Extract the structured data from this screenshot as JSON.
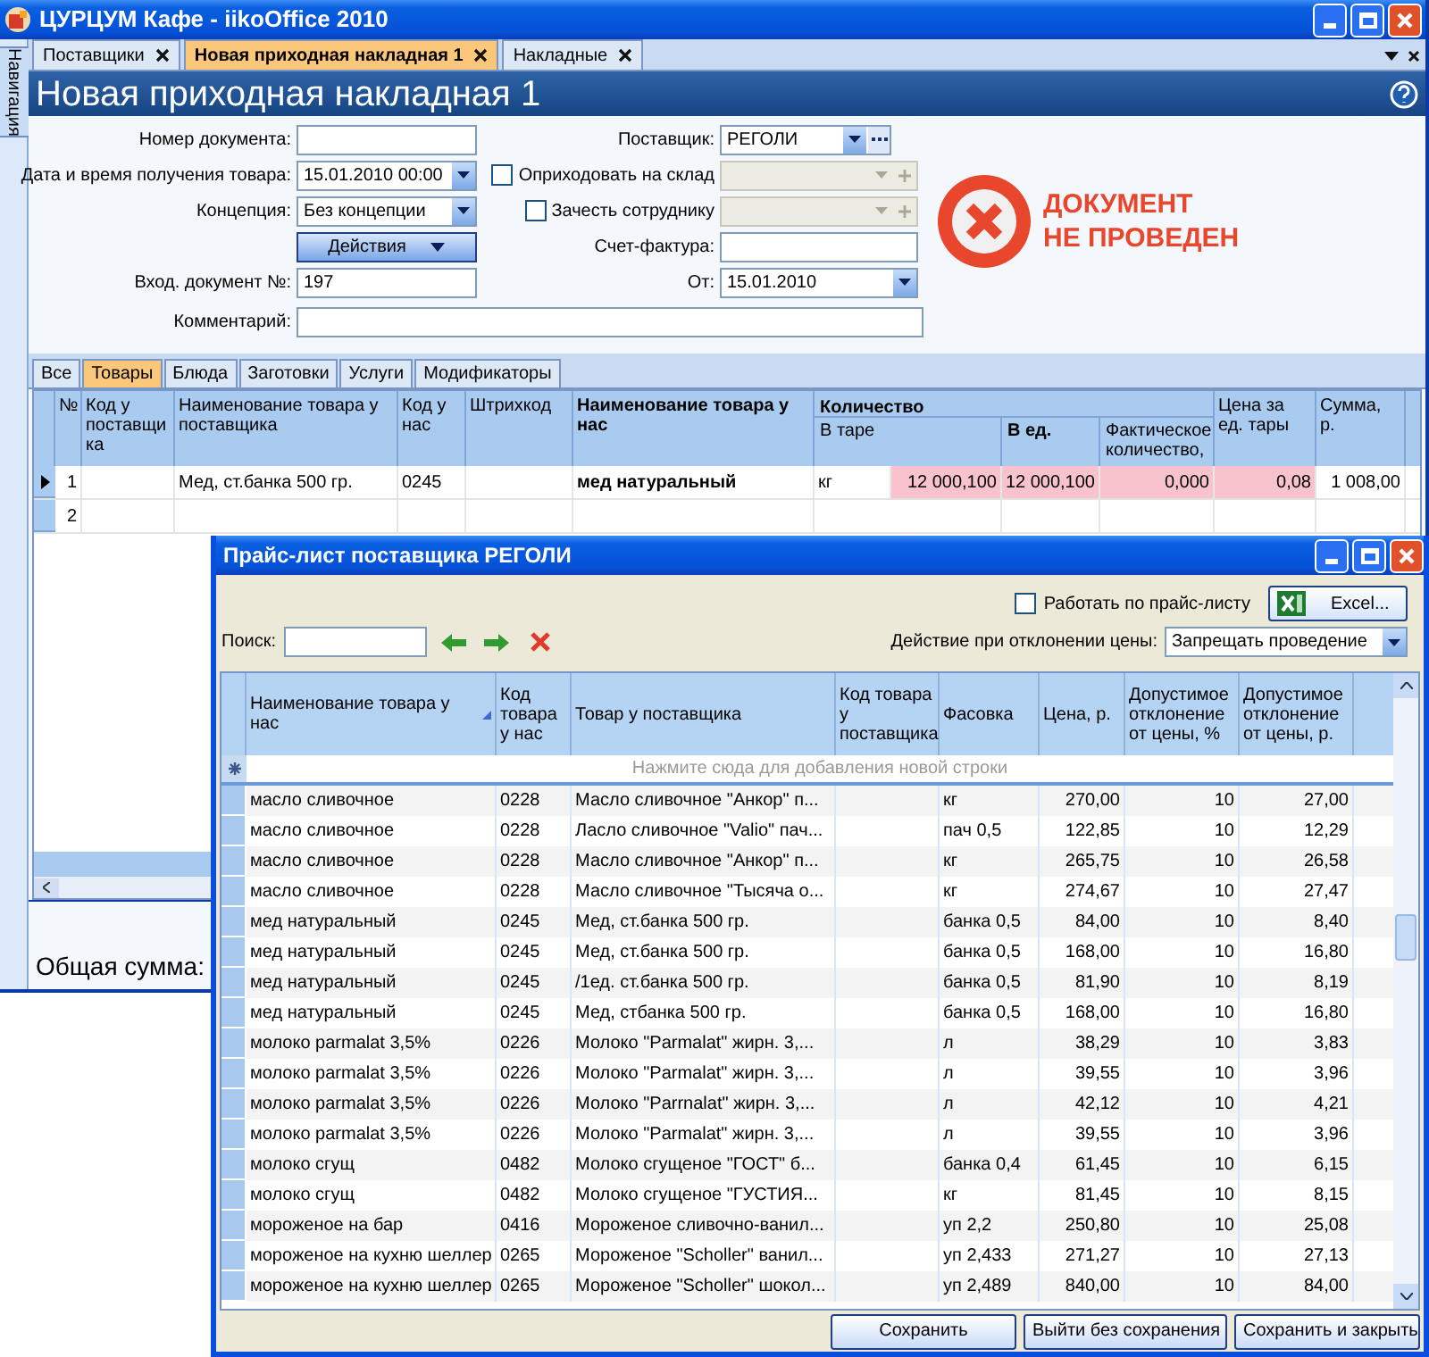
{
  "window": {
    "title": "ЦУРЦУМ Кафе - iikoOffice 2010"
  },
  "navigation_tab": {
    "label": "Навигация"
  },
  "tabs": [
    {
      "label": "Поставщики",
      "selected": false,
      "closable": true
    },
    {
      "label": "Новая приходная накладная 1",
      "selected": true,
      "closable": true
    },
    {
      "label": "Накладные",
      "selected": false,
      "closable": true
    }
  ],
  "header": {
    "title": "Новая приходная накладная 1"
  },
  "form": {
    "rows": [
      {
        "left": {
          "kind": "text",
          "label": "Номер документа:"
        },
        "right": {
          "kind": "dropdown_more",
          "label": "Поставщик:",
          "value": "РЕГОЛИ"
        }
      },
      {
        "left": {
          "kind": "dropdown",
          "label": "Дата и время получения товара:",
          "value": "15.01.2010 00:00"
        },
        "right": {
          "kind": "checkbox_field",
          "label": "Оприходовать на склад",
          "checked": false,
          "field_disabled": true
        }
      },
      {
        "left": {
          "kind": "dropdown",
          "label": "Концепция:",
          "value": "Без концепции"
        },
        "right": {
          "kind": "checkbox_field",
          "label": "Зачесть сотруднику",
          "checked": false,
          "field_disabled": true
        }
      },
      {
        "left": {
          "kind": "button",
          "label": "Действия"
        },
        "right": {
          "kind": "text",
          "label": "Счет-фактура:"
        }
      },
      {
        "left": {
          "kind": "text",
          "label": "Вход. документ №:",
          "value": "197"
        },
        "right": {
          "kind": "dropdown",
          "label": "От:",
          "value": "15.01.2010"
        }
      }
    ],
    "comment": {
      "label": "Комментарий:"
    },
    "status": {
      "posted": false,
      "lines": [
        "ДОКУМЕНТ",
        "НЕ ПРОВЕДЕН"
      ]
    }
  },
  "subtabs": [
    {
      "label": "Все",
      "selected": false
    },
    {
      "label": "Товары",
      "selected": true
    },
    {
      "label": "Блюда",
      "selected": false
    },
    {
      "label": "Заготовки",
      "selected": false
    },
    {
      "label": "Услуги",
      "selected": false
    },
    {
      "label": "Модификаторы",
      "selected": false
    }
  ],
  "table": {
    "column_group": {
      "label": "Количество",
      "bold": true
    },
    "columns": [
      {
        "label": "№",
        "bold": false
      },
      {
        "label": "Код у поставщика",
        "bold": false
      },
      {
        "label": "Наименование товара у поставщика",
        "bold": false
      },
      {
        "label": "Код у нас",
        "bold": false
      },
      {
        "label": "Штрихкод",
        "bold": false
      },
      {
        "label": "Наименование товара у нас",
        "bold": true
      },
      {
        "label": "В таре",
        "bold": false
      },
      {
        "label": "В ед.",
        "bold": true
      },
      {
        "label": "Фактическое количество,",
        "bold": false
      },
      {
        "label": "Цена за ед. тары",
        "bold": false
      },
      {
        "label": "Сумма, р.",
        "bold": false
      }
    ],
    "rows": [
      {
        "current": true,
        "cells": [
          {
            "text": "1",
            "bold": false,
            "highlight": false
          },
          {
            "highlight": false
          },
          {
            "text": "Мед, ст.банка 500 гр.",
            "bold": false,
            "highlight": false
          },
          {
            "text": "0245",
            "bold": false,
            "highlight": false
          },
          {
            "highlight": false
          },
          {
            "text": "мед натуральный",
            "bold": true,
            "highlight": false
          },
          {
            "unit": "кг",
            "text": "12 000,100",
            "bold": false,
            "highlight": true
          },
          {
            "text": "12 000,100",
            "bold": false,
            "highlight": true
          },
          {
            "text": "0,000",
            "bold": false,
            "highlight": true
          },
          {
            "text": "0,08",
            "bold": false,
            "highlight": true
          },
          {
            "text": "1 008,00",
            "bold": false,
            "highlight": false
          }
        ]
      },
      {
        "current": false,
        "cells": [
          {
            "text": "2",
            "bold": false,
            "highlight": false
          }
        ]
      }
    ]
  },
  "total": {
    "label": "Общая сумма:"
  },
  "dialog": {
    "title": "Прайс-лист поставщика РЕГОЛИ",
    "work_by_pricelist": {
      "label": "Работать по прайс-листу",
      "checked": false
    },
    "excel_button": {
      "label": "Excel..."
    },
    "search": {
      "label": "Поиск:"
    },
    "price_action": {
      "label": "Действие при отклонении цены:",
      "value": "Запрещать проведение"
    },
    "columns": [
      {
        "label": "Наименование товара у нас",
        "sorted": true
      },
      {
        "label": "Код товара у нас",
        "sorted": false
      },
      {
        "label": "Товар у поставщика",
        "sorted": false
      },
      {
        "label": "Код товара у поставщика",
        "sorted": false
      },
      {
        "label": "Фасовка",
        "sorted": false
      },
      {
        "label": "Цена, р.",
        "sorted": false
      },
      {
        "label": "Допустимое отклонение от цены, %",
        "sorted": false
      },
      {
        "label": "Допустимое отклонение от цены, р.",
        "sorted": false
      }
    ],
    "new_row_hint": "Нажмите сюда для добавления новой строки",
    "rows": [
      {
        "cells": [
          "масло сливочное",
          "0228",
          "Масло сливочное \"Анкор\" п...",
          "",
          "кг",
          "270,00",
          "10",
          "27,00"
        ]
      },
      {
        "cells": [
          "масло сливочное",
          "0228",
          "Ласло сливочное \"Valio\" пач...",
          "",
          "пач 0,5",
          "122,85",
          "10",
          "12,29"
        ]
      },
      {
        "cells": [
          "масло сливочное",
          "0228",
          "Масло сливочное \"Анкор\" п...",
          "",
          "кг",
          "265,75",
          "10",
          "26,58"
        ]
      },
      {
        "cells": [
          "масло сливочное",
          "0228",
          "Масло сливочное \"Тысяча о...",
          "",
          "кг",
          "274,67",
          "10",
          "27,47"
        ]
      },
      {
        "cells": [
          "мед натуральный",
          "0245",
          "Мед, ст.банка 500 гр.",
          "",
          "банка 0,5",
          "84,00",
          "10",
          "8,40"
        ]
      },
      {
        "cells": [
          "мед натуральный",
          "0245",
          "Мед, ст.банка 500 гр.",
          "",
          "банка 0,5",
          "168,00",
          "10",
          "16,80"
        ]
      },
      {
        "cells": [
          "мед натуральный",
          "0245",
          "/1ед. ст.банка 500 гр.",
          "",
          "банка 0,5",
          "81,90",
          "10",
          "8,19"
        ]
      },
      {
        "cells": [
          "мед натуральный",
          "0245",
          "Мед, стбанка 500 гр.",
          "",
          "банка 0,5",
          "168,00",
          "10",
          "16,80"
        ]
      },
      {
        "cells": [
          "молоко parmalat 3,5%",
          "0226",
          "Молоко \"Parmalat\" жирн. 3,...",
          "",
          "л",
          "38,29",
          "10",
          "3,83"
        ]
      },
      {
        "cells": [
          "молоко parmalat 3,5%",
          "0226",
          "Молоко \"Parmalat\" жирн. 3,...",
          "",
          "л",
          "39,55",
          "10",
          "3,96"
        ]
      },
      {
        "cells": [
          "молоко parmalat 3,5%",
          "0226",
          "Молоко \"Parrnalat\" жирн. 3,...",
          "",
          "л",
          "42,12",
          "10",
          "4,21"
        ]
      },
      {
        "cells": [
          "молоко parmalat 3,5%",
          "0226",
          "Молоко \"Parmalat\" жирн. 3,...",
          "",
          "л",
          "39,55",
          "10",
          "3,96"
        ]
      },
      {
        "cells": [
          "молоко сгущ",
          "0482",
          "Молоко сгущеное \"ГОСТ\" б...",
          "",
          "банка 0,4",
          "61,45",
          "10",
          "6,15"
        ]
      },
      {
        "cells": [
          "молоко сгущ",
          "0482",
          "Молоко сгущеное \"ГУСТИЯ...",
          "",
          "кг",
          "81,45",
          "10",
          "8,15"
        ]
      },
      {
        "cells": [
          "мороженое на бар",
          "0416",
          "Мороженое сливочно-ванил...",
          "",
          "уп 2,2",
          "250,80",
          "10",
          "25,08"
        ]
      },
      {
        "cells": [
          "мороженое на кухню шеллер",
          "0265",
          "Мороженое \"Scholler\" ванил...",
          "",
          "уп 2,433",
          "271,27",
          "10",
          "27,13"
        ]
      },
      {
        "cells": [
          "мороженое на кухню шеллер",
          "0265",
          "Мороженое \"Scholler\" шокол...",
          "",
          "уп 2,489",
          "840,00",
          "10",
          "84,00"
        ]
      }
    ],
    "buttons": [
      "Сохранить",
      "Выйти без сохранения",
      "Сохранить и закрыть"
    ]
  }
}
